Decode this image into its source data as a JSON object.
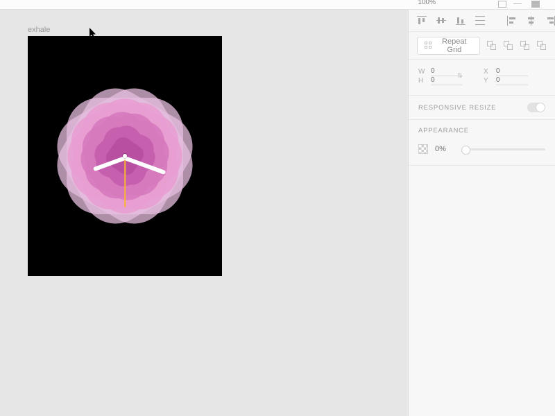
{
  "topbar": {
    "zoom": "100%"
  },
  "artboard": {
    "name": "exhale"
  },
  "panel": {
    "repeat_grid_label": "Repeat Grid",
    "dims": {
      "w_label": "W",
      "w_value": "0",
      "h_label": "H",
      "h_value": "0",
      "x_label": "X",
      "x_value": "0",
      "y_label": "Y",
      "y_value": "0"
    },
    "responsive_label": "RESPONSIVE RESIZE",
    "appearance_label": "APPEARANCE",
    "opacity": "0%"
  }
}
